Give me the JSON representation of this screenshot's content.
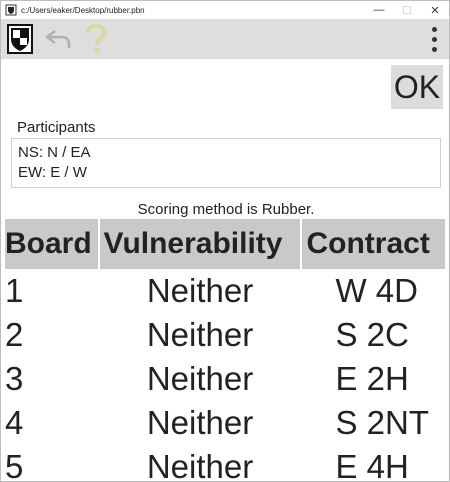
{
  "window": {
    "title": "c:/Users/eaker/Desktop/rubber.pbn",
    "controls": {
      "minimize": "—",
      "maximize": "☐",
      "close": "✕"
    }
  },
  "toolbar": {
    "icons": [
      "shield-icon",
      "undo-icon",
      "help-icon"
    ],
    "menu_icon": "more-vert-icon"
  },
  "dialog": {
    "ok_label": "OK",
    "participants_label": "Participants",
    "participants": {
      "ns": "NS:  N / EA",
      "ew": "EW:  E / W"
    },
    "scoring_text": "Scoring method is Rubber."
  },
  "table": {
    "headers": [
      "Board",
      "Vulnerability",
      "Contract"
    ],
    "rows": [
      {
        "board": "1",
        "vulnerability": "Neither",
        "contract": "W 4D"
      },
      {
        "board": "2",
        "vulnerability": "Neither",
        "contract": "S 2C"
      },
      {
        "board": "3",
        "vulnerability": "Neither",
        "contract": "E 2H"
      },
      {
        "board": "4",
        "vulnerability": "Neither",
        "contract": "S 2NT"
      },
      {
        "board": "5",
        "vulnerability": "Neither",
        "contract": "E 4H"
      }
    ]
  },
  "colors": {
    "toolbar_bg": "#dedede",
    "header_bg": "#c9c9c9",
    "ok_bg": "#dcdcdc",
    "text": "#222222"
  }
}
